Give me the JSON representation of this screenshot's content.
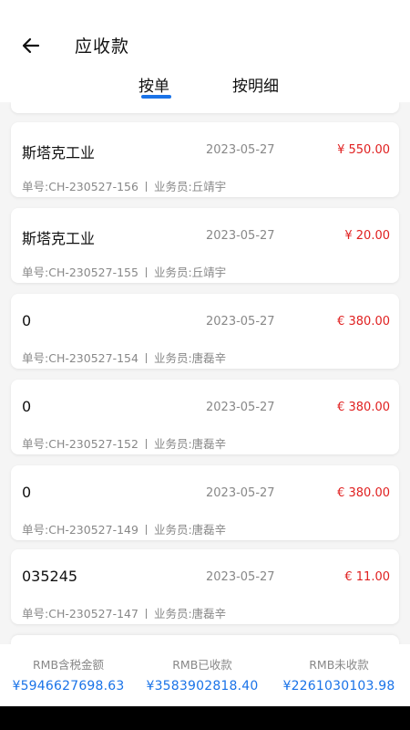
{
  "header": {
    "title": "应收款",
    "tabs": [
      "按单",
      "按明细"
    ]
  },
  "records": [
    {
      "customer": "斯塔克工业",
      "date": "2023-05-27",
      "amount": "¥ 550.00",
      "order_no": "单号:CH-230527-156",
      "salesperson": "业务员:丘靖宇"
    },
    {
      "customer": "斯塔克工业",
      "date": "2023-05-27",
      "amount": "¥ 20.00",
      "order_no": "单号:CH-230527-155",
      "salesperson": "业务员:丘靖宇"
    },
    {
      "customer": "0",
      "date": "2023-05-27",
      "amount": "€ 380.00",
      "order_no": "单号:CH-230527-154",
      "salesperson": "业务员:唐磊辛"
    },
    {
      "customer": "0",
      "date": "2023-05-27",
      "amount": "€ 380.00",
      "order_no": "单号:CH-230527-152",
      "salesperson": "业务员:唐磊辛"
    },
    {
      "customer": "0",
      "date": "2023-05-27",
      "amount": "€ 380.00",
      "order_no": "单号:CH-230527-149",
      "salesperson": "业务员:唐磊辛"
    },
    {
      "customer": "035245",
      "date": "2023-05-27",
      "amount": "€ 11.00",
      "order_no": "单号:CH-230527-147",
      "salesperson": "业务员:唐磊辛"
    }
  ],
  "summary": [
    {
      "label": "RMB含税金额",
      "value": "¥5946627698.63"
    },
    {
      "label": "RMB已收款",
      "value": "¥3583902818.40"
    },
    {
      "label": "RMB未收款",
      "value": "¥2261030103.98"
    }
  ],
  "colors": {
    "accent": "#1a73e8",
    "amount": "#e02020",
    "secondary_text": "#888888",
    "list_background": "#f5f5f5"
  }
}
